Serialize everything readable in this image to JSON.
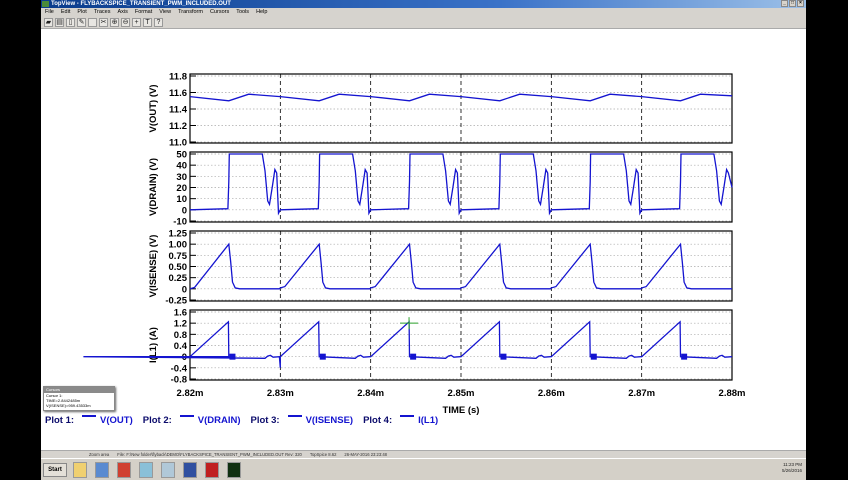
{
  "window": {
    "title": "TopView - FLYBACKSPICE_TRANSIENT_PWM_INCLUDED.OUT"
  },
  "menu": [
    "File",
    "Edit",
    "Plot",
    "Traces",
    "Axis",
    "Format",
    "View",
    "Transform",
    "Cursors",
    "Tools",
    "Help"
  ],
  "toolbar_icons": [
    "open-icon",
    "print-icon",
    "copy-icon",
    "edit-icon",
    "blank-icon",
    "cut-icon",
    "zoom-in-icon",
    "zoom-out-icon",
    "crosshair-icon",
    "text-icon",
    "help-icon"
  ],
  "cursor_box": {
    "title": "Cursors",
    "line1": "Cursor 1:",
    "line2": "TIME=2.8442485m",
    "line3": "V(ISENSE)=959.43533m"
  },
  "legend": [
    {
      "plot": "Plot 1:",
      "name": "V(OUT)"
    },
    {
      "plot": "Plot 2:",
      "name": "V(DRAIN)"
    },
    {
      "plot": "Plot 3:",
      "name": "V(ISENSE)"
    },
    {
      "plot": "Plot 4:",
      "name": "I(L1)"
    }
  ],
  "status": {
    "mode": "Zoom area",
    "file": "File: F:\\New folder\\flyback\\DEMO\\FLYBACKSPICE_TRANSIENT_PWM_INCLUDED.OUT  Rev: 320",
    "version": "TopSpice 8.62",
    "date": "26-MAY-2016 23:23:48"
  },
  "taskbar": {
    "start": "Start",
    "time": "11:23 PM",
    "date": "5/26/2016"
  },
  "colors": {
    "trace": "#1414d0",
    "cursor": "#2aa02a"
  },
  "chart_data": {
    "type": "line",
    "xlabel": "TIME  (s)",
    "xlim": [
      2.82,
      2.88
    ],
    "xticks": [
      "2.82m",
      "2.83m",
      "2.84m",
      "2.85m",
      "2.86m",
      "2.87m",
      "2.88m"
    ],
    "xtick_values": [
      2.82,
      2.83,
      2.84,
      2.85,
      2.86,
      2.87,
      2.88
    ],
    "grid": true,
    "cursor": {
      "x": 2.8442485
    },
    "panels": [
      {
        "ylabel": "V(OUT)  (V)",
        "ylim": [
          11.0,
          11.8
        ],
        "yticks": [
          "11.8",
          "11.6",
          "11.4",
          "11.2",
          "11.0"
        ],
        "ytick_values": [
          11.8,
          11.6,
          11.4,
          11.2,
          11.0
        ],
        "series": {
          "name": "V(OUT)",
          "points": [
            [
              2.82,
              11.55
            ],
            [
              2.8243,
              11.5
            ],
            [
              2.8265,
              11.58
            ],
            [
              2.83,
              11.55
            ],
            [
              2.8343,
              11.5
            ],
            [
              2.8365,
              11.58
            ],
            [
              2.84,
              11.55
            ],
            [
              2.8443,
              11.5
            ],
            [
              2.8465,
              11.58
            ],
            [
              2.85,
              11.55
            ],
            [
              2.8543,
              11.5
            ],
            [
              2.8565,
              11.58
            ],
            [
              2.86,
              11.55
            ],
            [
              2.8643,
              11.5
            ],
            [
              2.8665,
              11.58
            ],
            [
              2.87,
              11.55
            ],
            [
              2.8743,
              11.5
            ],
            [
              2.8765,
              11.58
            ],
            [
              2.88,
              11.56
            ]
          ]
        }
      },
      {
        "ylabel": "V(DRAIN)  (V)",
        "ylim": [
          -10,
          50
        ],
        "yticks": [
          "50",
          "40",
          "30",
          "20",
          "10",
          "0",
          "-10"
        ],
        "ytick_values": [
          50,
          40,
          30,
          20,
          10,
          0,
          -10
        ],
        "series": {
          "name": "V(DRAIN)",
          "points": [
            [
              2.82,
              0
            ],
            [
              2.8242,
              1
            ],
            [
              2.8243,
              25
            ],
            [
              2.82435,
              50
            ],
            [
              2.828,
              50
            ],
            [
              2.8283,
              35
            ],
            [
              2.8286,
              8
            ],
            [
              2.8288,
              5
            ],
            [
              2.8291,
              20
            ],
            [
              2.8294,
              36
            ],
            [
              2.8296,
              33
            ],
            [
              2.8298,
              -3
            ],
            [
              2.83,
              0
            ],
            [
              2.8342,
              1
            ],
            [
              2.8343,
              25
            ],
            [
              2.83435,
              50
            ],
            [
              2.838,
              50
            ],
            [
              2.8383,
              35
            ],
            [
              2.8386,
              8
            ],
            [
              2.8388,
              5
            ],
            [
              2.8391,
              20
            ],
            [
              2.8394,
              36
            ],
            [
              2.8396,
              33
            ],
            [
              2.8398,
              -3
            ],
            [
              2.84,
              0
            ],
            [
              2.8442,
              1
            ],
            [
              2.8443,
              25
            ],
            [
              2.84435,
              50
            ],
            [
              2.848,
              50
            ],
            [
              2.8483,
              35
            ],
            [
              2.8486,
              8
            ],
            [
              2.8488,
              5
            ],
            [
              2.8491,
              20
            ],
            [
              2.8494,
              36
            ],
            [
              2.8496,
              33
            ],
            [
              2.8498,
              -3
            ],
            [
              2.85,
              0
            ],
            [
              2.8542,
              1
            ],
            [
              2.8543,
              25
            ],
            [
              2.85435,
              50
            ],
            [
              2.858,
              50
            ],
            [
              2.8583,
              35
            ],
            [
              2.8586,
              8
            ],
            [
              2.8588,
              5
            ],
            [
              2.8591,
              20
            ],
            [
              2.8594,
              36
            ],
            [
              2.8596,
              33
            ],
            [
              2.8598,
              -3
            ],
            [
              2.86,
              0
            ],
            [
              2.8642,
              1
            ],
            [
              2.8643,
              25
            ],
            [
              2.86435,
              50
            ],
            [
              2.868,
              50
            ],
            [
              2.8683,
              35
            ],
            [
              2.8686,
              8
            ],
            [
              2.8688,
              5
            ],
            [
              2.8691,
              20
            ],
            [
              2.8694,
              36
            ],
            [
              2.8696,
              33
            ],
            [
              2.8698,
              -3
            ],
            [
              2.87,
              0
            ],
            [
              2.8742,
              1
            ],
            [
              2.8743,
              25
            ],
            [
              2.87435,
              50
            ],
            [
              2.878,
              50
            ],
            [
              2.8783,
              35
            ],
            [
              2.8786,
              8
            ],
            [
              2.8788,
              5
            ],
            [
              2.8791,
              20
            ],
            [
              2.8794,
              36
            ],
            [
              2.8796,
              33
            ],
            [
              2.88,
              20
            ]
          ]
        }
      },
      {
        "ylabel": "V(ISENSE)  (V)",
        "ylim": [
          -0.25,
          1.25
        ],
        "yticks": [
          "1.25",
          "1.00",
          "0.75",
          "0.50",
          "0.25",
          "0",
          "-0.25"
        ],
        "ytick_values": [
          1.25,
          1.0,
          0.75,
          0.5,
          0.25,
          0,
          -0.25
        ],
        "series": {
          "name": "V(ISENSE)",
          "points": [
            [
              2.82,
              0
            ],
            [
              2.8205,
              0.03
            ],
            [
              2.8243,
              1.0
            ],
            [
              2.8245,
              0.6
            ],
            [
              2.8247,
              0.15
            ],
            [
              2.825,
              0.02
            ],
            [
              2.8255,
              0
            ],
            [
              2.8299,
              0
            ],
            [
              2.83,
              0.02
            ],
            [
              2.8305,
              0.05
            ],
            [
              2.8343,
              1.0
            ],
            [
              2.8345,
              0.6
            ],
            [
              2.8347,
              0.15
            ],
            [
              2.835,
              0.02
            ],
            [
              2.8355,
              0
            ],
            [
              2.8399,
              0
            ],
            [
              2.84,
              0.02
            ],
            [
              2.8405,
              0.05
            ],
            [
              2.8443,
              1.0
            ],
            [
              2.8445,
              0.6
            ],
            [
              2.8447,
              0.15
            ],
            [
              2.845,
              0.02
            ],
            [
              2.8455,
              0
            ],
            [
              2.8499,
              0
            ],
            [
              2.85,
              0.02
            ],
            [
              2.8505,
              0.05
            ],
            [
              2.8543,
              1.0
            ],
            [
              2.8545,
              0.6
            ],
            [
              2.8547,
              0.15
            ],
            [
              2.855,
              0.02
            ],
            [
              2.8555,
              0
            ],
            [
              2.8599,
              0
            ],
            [
              2.86,
              0.02
            ],
            [
              2.8605,
              0.05
            ],
            [
              2.8643,
              1.0
            ],
            [
              2.8645,
              0.6
            ],
            [
              2.8647,
              0.15
            ],
            [
              2.865,
              0.02
            ],
            [
              2.8655,
              0
            ],
            [
              2.8699,
              0
            ],
            [
              2.87,
              0.02
            ],
            [
              2.8705,
              0.05
            ],
            [
              2.8743,
              1.0
            ],
            [
              2.8745,
              0.6
            ],
            [
              2.8747,
              0.15
            ],
            [
              2.875,
              0.02
            ],
            [
              2.8755,
              0
            ],
            [
              2.88,
              0
            ]
          ]
        }
      },
      {
        "ylabel": "I(L1)  (A)",
        "ylim": [
          -0.8,
          1.6
        ],
        "yticks": [
          "1.6",
          "1.2",
          "0.8",
          "0.4",
          "0",
          "-0.4",
          "-0.8"
        ],
        "ytick_values": [
          1.6,
          1.2,
          0.8,
          0.4,
          0,
          -0.4,
          -0.8
        ],
        "series": {
          "name": "I(L1)",
          "points": [
            [
              2.82,
              0
            ],
            [
              2.82425,
              1.25
            ],
            [
              2.8243,
              0
            ],
            [
              2.8082,
              0
            ],
            [
              2.8283,
              -0.06
            ],
            [
              2.8286,
              0.02
            ],
            [
              2.8289,
              0.05
            ],
            [
              2.8292,
              -0.02
            ],
            [
              2.8299,
              0
            ],
            [
              2.83,
              -0.4
            ],
            [
              2.83,
              0
            ],
            [
              2.83425,
              1.25
            ],
            [
              2.8343,
              0
            ],
            [
              2.8383,
              -0.06
            ],
            [
              2.8386,
              0.02
            ],
            [
              2.8389,
              0.05
            ],
            [
              2.8392,
              -0.02
            ],
            [
              2.8399,
              0
            ],
            [
              2.84,
              0
            ],
            [
              2.84425,
              1.25
            ],
            [
              2.8443,
              0
            ],
            [
              2.8483,
              -0.06
            ],
            [
              2.8486,
              0.02
            ],
            [
              2.8489,
              0.05
            ],
            [
              2.8492,
              -0.02
            ],
            [
              2.8499,
              0
            ],
            [
              2.85,
              0
            ],
            [
              2.85425,
              1.25
            ],
            [
              2.8543,
              0
            ],
            [
              2.8583,
              -0.06
            ],
            [
              2.8586,
              0.02
            ],
            [
              2.8589,
              0.05
            ],
            [
              2.8592,
              -0.02
            ],
            [
              2.8599,
              0
            ],
            [
              2.86,
              0
            ],
            [
              2.86425,
              1.25
            ],
            [
              2.8643,
              0
            ],
            [
              2.8683,
              -0.06
            ],
            [
              2.8686,
              0.02
            ],
            [
              2.8689,
              0.05
            ],
            [
              2.8692,
              -0.02
            ],
            [
              2.8699,
              0
            ],
            [
              2.87,
              0
            ],
            [
              2.87425,
              1.25
            ],
            [
              2.8743,
              0
            ],
            [
              2.8783,
              -0.06
            ],
            [
              2.8786,
              0.02
            ],
            [
              2.8789,
              0.05
            ],
            [
              2.8792,
              -0.02
            ],
            [
              2.88,
              0
            ]
          ],
          "markers": [
            [
              2.8247,
              0
            ],
            [
              2.8347,
              0
            ],
            [
              2.8447,
              0
            ],
            [
              2.8547,
              0
            ],
            [
              2.8647,
              0
            ],
            [
              2.8747,
              0
            ]
          ]
        }
      }
    ]
  }
}
